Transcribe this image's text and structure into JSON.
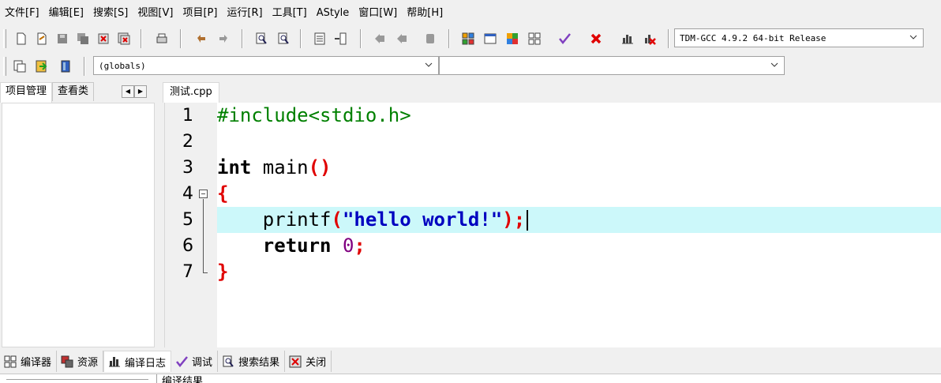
{
  "menu": [
    "文件[F]",
    "编辑[E]",
    "搜索[S]",
    "视图[V]",
    "项目[P]",
    "运行[R]",
    "工具[T]",
    "AStyle",
    "窗口[W]",
    "帮助[H]"
  ],
  "toolbar": {
    "compiler_select": "TDM-GCC 4.9.2 64-bit Release",
    "globals_select": "(globals)",
    "member_select": ""
  },
  "left_panel": {
    "tabs": [
      "项目管理",
      "查看类"
    ]
  },
  "editor": {
    "file_tab": "测试.cpp",
    "current_line": 5,
    "line_numbers": [
      "1",
      "2",
      "3",
      "4",
      "5",
      "6",
      "7"
    ],
    "code": {
      "l1": "#include<stdio.h>",
      "l3_kw": "int",
      "l3_rest": " main",
      "l3_paren": "()",
      "l4": "{",
      "l5_indent": "    printf",
      "l5_open": "(",
      "l5_str": "\"hello world!\"",
      "l5_close": ");",
      "l6_indent": "    ",
      "l6_kw": "return",
      "l6_num": "0",
      "l6_semi": ";",
      "l7": "}"
    }
  },
  "bottom_tabs": [
    "编译器",
    "资源",
    "编译日志",
    "调试",
    "搜索结果",
    "关闭"
  ],
  "bottom_active": "编译日志",
  "bottom_panel": {
    "results_label": "编译结果"
  },
  "colors": {
    "current_line": "#ccf8fa",
    "preprocessor": "#008000",
    "symbol": "#e00000",
    "string": "#0000c0",
    "number": "#800080"
  }
}
